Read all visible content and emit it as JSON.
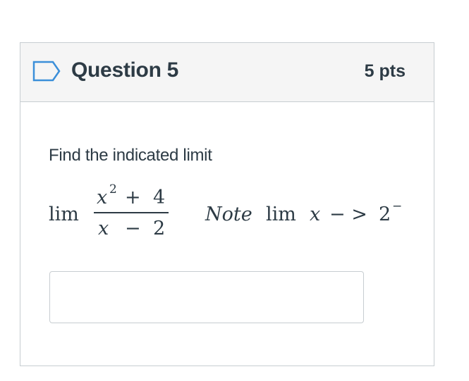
{
  "question": {
    "title": "Question 5",
    "points": "5 pts",
    "flag_icon": "bookmark-flag-icon",
    "prompt": "Find the indicated limit",
    "expression": {
      "lim": "lim",
      "numerator": {
        "var": "x",
        "exponent": "2",
        "op": "+",
        "constant": "4"
      },
      "denominator": {
        "var": "x",
        "op": "−",
        "constant": "2"
      },
      "note": {
        "note_word": "Note",
        "lim": "lim",
        "var": "x",
        "arrow": "− >",
        "target": "2",
        "side": "−"
      }
    },
    "answer": {
      "value": "",
      "placeholder": ""
    }
  },
  "colors": {
    "text": "#2d3b45",
    "border": "#c7cdd1",
    "header_bg": "#f5f5f5",
    "flag_stroke": "#3b8fd9"
  }
}
